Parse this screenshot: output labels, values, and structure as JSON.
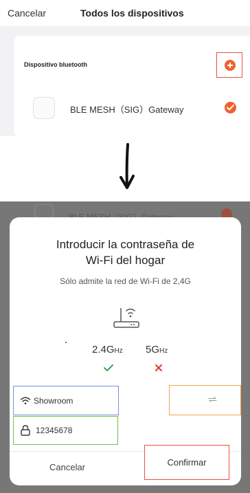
{
  "top_nav": {
    "cancel_label": "Cancelar",
    "title": "Todos los dispositivos"
  },
  "bluetooth_card": {
    "section_label": "Dispositivo bluetooth",
    "add_icon": "plus-circle-icon",
    "device": {
      "name": "BLE MESH（SIG）Gateway",
      "selected": true
    }
  },
  "background_row": {
    "name": "BLE MESH（SIG）Gateway"
  },
  "dialog": {
    "title_line1": "Introducir la contraseña de",
    "title_line2": "Wi-Fi del hogar",
    "subtitle": "Sólo admite la red de Wi-Fi de 2,4G",
    "bands": {
      "band_24_main": "2.4G",
      "band_24_unit": "Hz",
      "band_24_supported": true,
      "band_5_main": "5G",
      "band_5_unit": "Hz",
      "band_5_supported": false
    },
    "ssid_value": "Showroom",
    "password_value": "12345678",
    "cancel_label": "Cancelar",
    "confirm_label": "Confirmar"
  },
  "colors": {
    "accent_orange": "#f0612e",
    "highlight_red": "#e8503a",
    "ssid_box_blue": "#7a8fd8",
    "password_box_green": "#6bbf4e",
    "switch_box_orange": "#f2a34a",
    "check_green": "#3aa85a",
    "cross_red": "#e53935"
  }
}
